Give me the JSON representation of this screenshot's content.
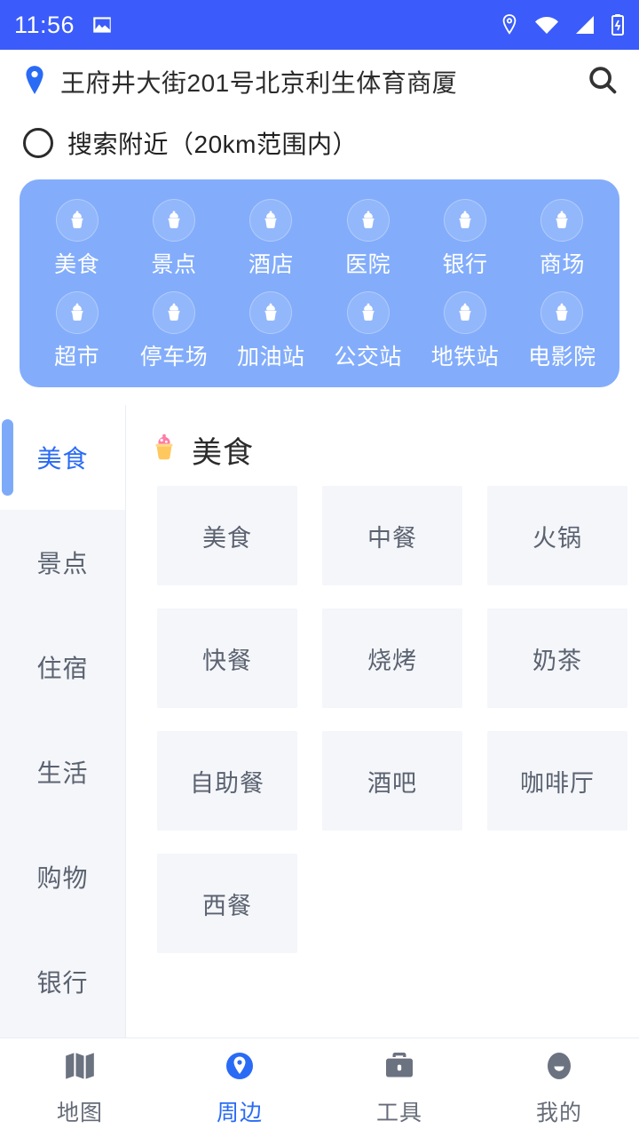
{
  "status_bar": {
    "time": "11:56",
    "left_icons": [
      "image-icon"
    ],
    "right_icons": [
      "location-pin-icon",
      "wifi-icon",
      "cellular-signal-icon",
      "battery-charging-icon"
    ],
    "background_color": "#3b5cfa"
  },
  "header": {
    "location_icon": "location-pin-icon",
    "address": "王府井大街201号北京利生体育商厦",
    "search_icon": "search-icon"
  },
  "nearby": {
    "checked": false,
    "label": "搜索附近（20km范围内）"
  },
  "quick_panel": {
    "background_color": "#83adfb",
    "items": [
      {
        "label": "美食",
        "icon": "cupcake-icon"
      },
      {
        "label": "景点",
        "icon": "cupcake-icon"
      },
      {
        "label": "酒店",
        "icon": "cupcake-icon"
      },
      {
        "label": "医院",
        "icon": "cupcake-icon"
      },
      {
        "label": "银行",
        "icon": "cupcake-icon"
      },
      {
        "label": "商场",
        "icon": "cupcake-icon"
      },
      {
        "label": "超市",
        "icon": "cupcake-icon"
      },
      {
        "label": "停车场",
        "icon": "cupcake-icon"
      },
      {
        "label": "加油站",
        "icon": "cupcake-icon"
      },
      {
        "label": "公交站",
        "icon": "cupcake-icon"
      },
      {
        "label": "地铁站",
        "icon": "cupcake-icon"
      },
      {
        "label": "电影院",
        "icon": "cupcake-icon"
      }
    ]
  },
  "side_nav": {
    "active_index": 0,
    "active_color": "#2a6bf5",
    "indicator_color": "#7daaf8",
    "items": [
      {
        "label": "美食"
      },
      {
        "label": "景点"
      },
      {
        "label": "住宿"
      },
      {
        "label": "生活"
      },
      {
        "label": "购物"
      },
      {
        "label": "银行"
      }
    ]
  },
  "section": {
    "icon": "cupcake-emoji",
    "title": "美食",
    "cards": [
      {
        "label": "美食"
      },
      {
        "label": "中餐"
      },
      {
        "label": "火锅"
      },
      {
        "label": "快餐"
      },
      {
        "label": "烧烤"
      },
      {
        "label": "奶茶"
      },
      {
        "label": "自助餐"
      },
      {
        "label": "酒吧"
      },
      {
        "label": "咖啡厅"
      },
      {
        "label": "西餐"
      }
    ]
  },
  "bottom_nav": {
    "active_index": 1,
    "active_color": "#2a6bf5",
    "items": [
      {
        "label": "地图",
        "icon": "map-icon"
      },
      {
        "label": "周边",
        "icon": "location-pin-filled-icon"
      },
      {
        "label": "工具",
        "icon": "briefcase-icon"
      },
      {
        "label": "我的",
        "icon": "account-avatar-icon"
      }
    ]
  }
}
